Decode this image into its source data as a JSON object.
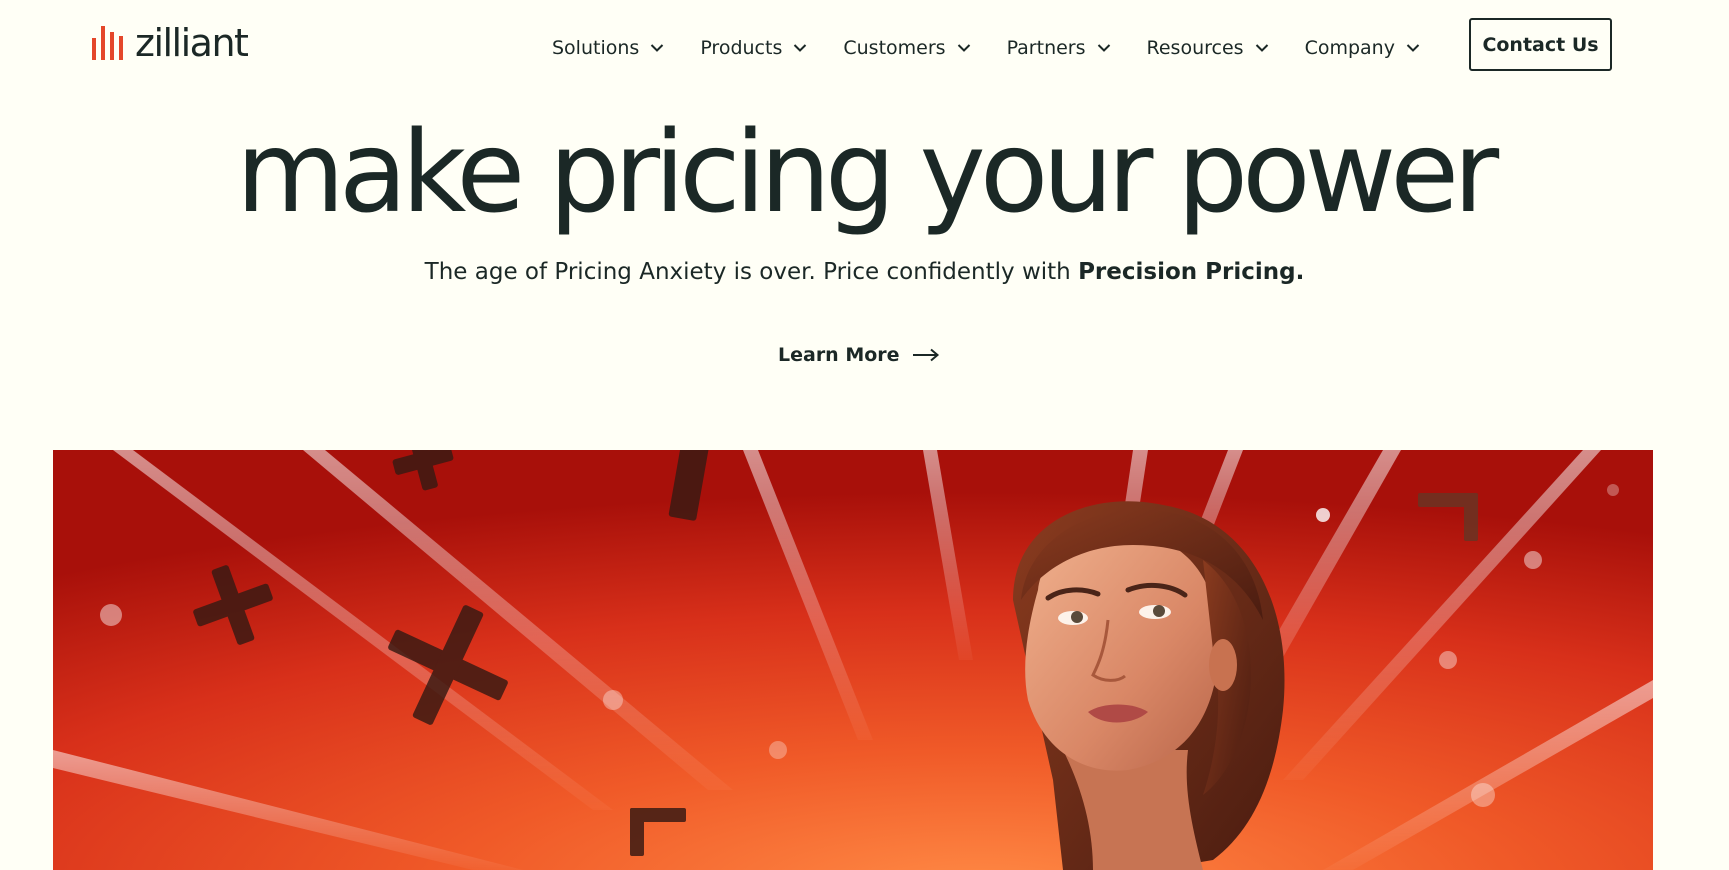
{
  "brand": {
    "name": "zilliant",
    "accent_color": "#e4472a",
    "text_color": "#1b2826",
    "background_color": "#fffff6"
  },
  "nav": {
    "items": [
      {
        "label": "Solutions",
        "icon": "chevron-down-icon"
      },
      {
        "label": "Products",
        "icon": "chevron-down-icon"
      },
      {
        "label": "Customers",
        "icon": "chevron-down-icon"
      },
      {
        "label": "Partners",
        "icon": "chevron-down-icon"
      },
      {
        "label": "Resources",
        "icon": "chevron-down-icon"
      },
      {
        "label": "Company",
        "icon": "chevron-down-icon"
      }
    ],
    "contact_label": "Contact Us"
  },
  "hero": {
    "title": "make pricing your power",
    "subtitle_prefix": "The age of Pricing Anxiety is over. Price confidently with ",
    "subtitle_bold": "Precision Pricing.",
    "cta_label": "Learn More",
    "cta_icon": "arrow-right-icon"
  },
  "hero_image": {
    "description_icon": "hero-photo",
    "background_colors": [
      "#b8150c",
      "#e2381c",
      "#f26a30"
    ]
  }
}
